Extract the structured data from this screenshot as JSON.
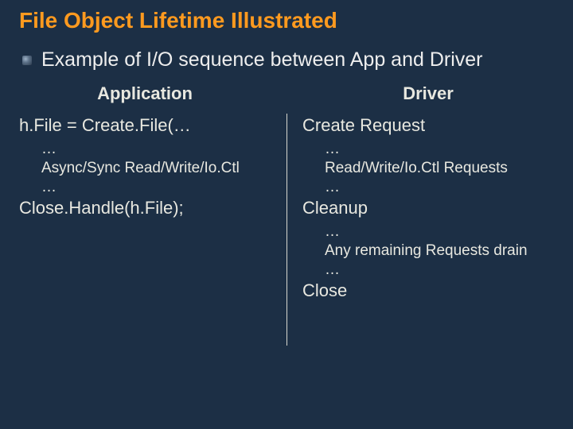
{
  "title": "File Object Lifetime Illustrated",
  "bullet": "Example of I/O sequence between App and Driver",
  "left": {
    "header": "Application",
    "l1": "h.File = Create.File(…",
    "s1": "…",
    "s2": "Async/Sync Read/Write/Io.Ctl",
    "s3": "…",
    "l2": "Close.Handle(h.File);"
  },
  "right": {
    "header": "Driver",
    "l1": "Create Request",
    "s1": "…",
    "s2": "Read/Write/Io.Ctl Requests",
    "s3": "…",
    "l2": "Cleanup",
    "s4": "…",
    "s5": "Any remaining Requests drain",
    "s6": "…",
    "l3": "Close"
  }
}
